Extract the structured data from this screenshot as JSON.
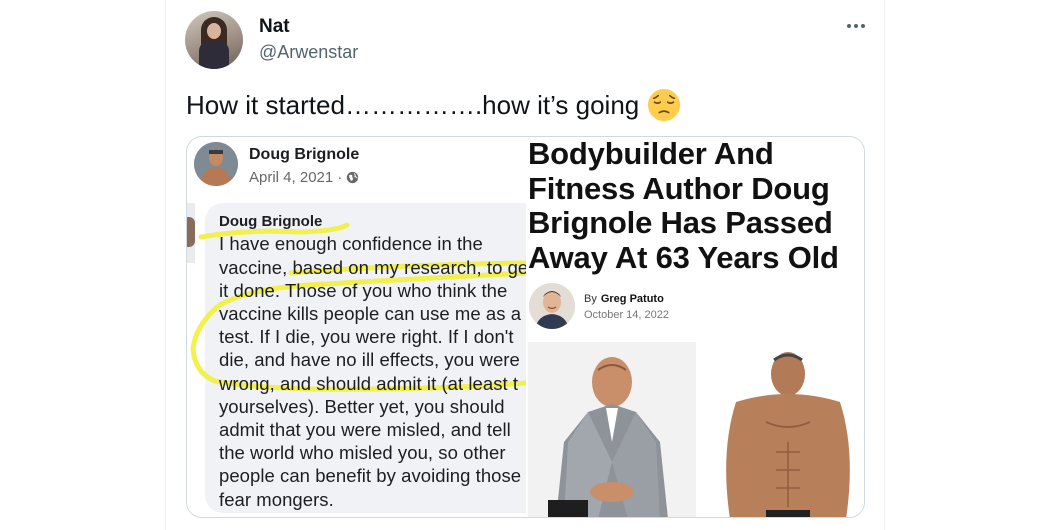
{
  "tweet": {
    "display_name": "Nat",
    "handle": "@Arwenstar",
    "text": "How it started…………….how it’s going",
    "emoji": "pensive-face-emoji",
    "more_icon": "more-horizontal-icon"
  },
  "facebook_post": {
    "author": "Doug Brignole",
    "date": "April 4, 2021 · ",
    "privacy_icon": "globe-icon",
    "comment_author": "Doug Brignole",
    "comment_lines": [
      "I have enough confidence in the",
      "vaccine, based on my research, to ge",
      "it done. Those of you who think the",
      "vaccine kills people can use me as a",
      "test. If I die, you were right. If I don't",
      "die, and have no ill effects, you were",
      "wrong, and should admit it (at least t",
      "yourselves). Better yet, you should",
      "admit that you were misled, and tell",
      "the world who misled you, so other",
      "people can benefit by avoiding those",
      "fear mongers."
    ],
    "highlight_color": "#f2ef3a"
  },
  "article": {
    "headline_lines": [
      "Bodybuilder And",
      "Fitness Author Doug",
      "Brignole Has Passed",
      "Away At 63 Years Old"
    ],
    "by_label": "By",
    "author": "Greg Patuto",
    "date": "October 14, 2022"
  },
  "colors": {
    "text_primary": "#0f1419",
    "text_secondary": "#536471",
    "border": "#cfd9de"
  }
}
